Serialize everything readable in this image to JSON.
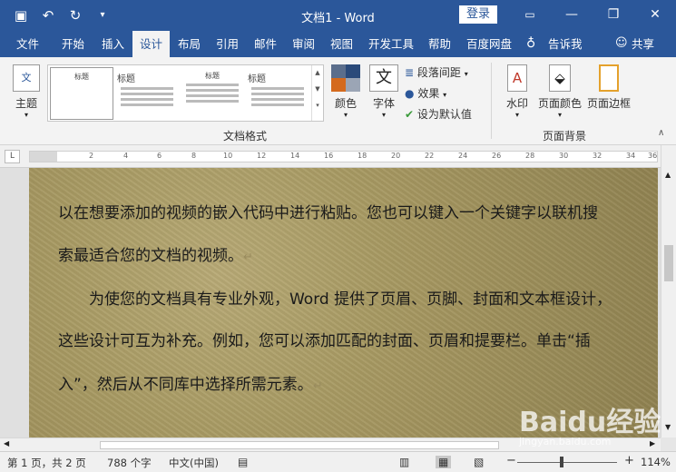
{
  "titlebar": {
    "title": "文档1 - Word",
    "login": "登录",
    "minimize": "—",
    "restore": "❐",
    "close": "✕"
  },
  "tabs": {
    "file": "文件",
    "home": "开始",
    "insert": "插入",
    "design": "设计",
    "layout": "布局",
    "references": "引用",
    "mailings": "邮件",
    "review": "审阅",
    "view": "视图",
    "developer": "开发工具",
    "help": "帮助",
    "baidu": "百度网盘",
    "tellme": "告诉我",
    "share": "共享"
  },
  "ribbon": {
    "theme": "主题",
    "gallery_items": [
      "标题",
      "标题",
      "标题",
      "标题"
    ],
    "colors": "颜色",
    "fonts": "字体",
    "paragraph_spacing": "段落间距",
    "effects": "效果",
    "set_default": "设为默认值",
    "group_doc_format": "文档格式",
    "watermark": "水印",
    "page_color": "页面颜色",
    "page_border": "页面边框",
    "group_page_bg": "页面背景"
  },
  "ruler": {
    "tab_selector": "L",
    "ticks": [
      "2",
      "4",
      "6",
      "8",
      "10",
      "12",
      "14",
      "16",
      "18",
      "20",
      "22",
      "24",
      "26",
      "28",
      "30",
      "32",
      "34",
      "36"
    ]
  },
  "document": {
    "lines": [
      "以在想要添加的视频的嵌入代码中进行粘贴。您也可以键入一个关键字以联机搜",
      "索最适合您的文档的视频。",
      "为使您的文档具有专业外观，Word 提供了页眉、页脚、封面和文本框设计，",
      "这些设计可互为补充。例如，您可以添加匹配的封面、页眉和提要栏。单击“插",
      "入”，然后从不同库中选择所需元素。"
    ],
    "para_mark": "↵"
  },
  "statusbar": {
    "page": "第 1 页，共 2 页",
    "words": "788 个字",
    "language": "中文(中国)",
    "zoom": "114%"
  },
  "watermark": {
    "brand": "Baidu经验",
    "url": "jingyan.baidu.com"
  },
  "colors": {
    "titlebar": "#2b579a",
    "page_background": "#a89a63"
  }
}
